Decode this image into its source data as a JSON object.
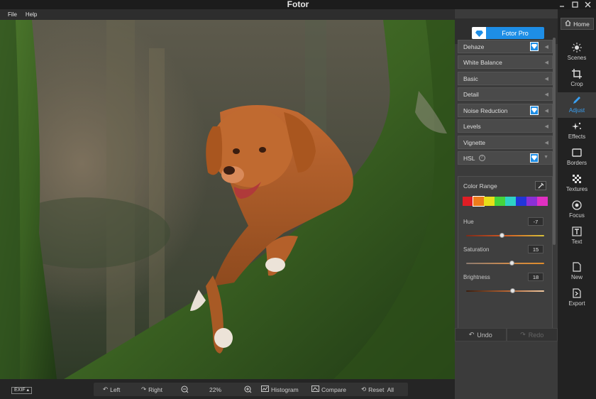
{
  "window": {
    "title": "Fotor",
    "minimize_icon": "minimize-icon",
    "maximize_icon": "maximize-icon",
    "close_icon": "close-icon"
  },
  "menu": [
    "File",
    "Help"
  ],
  "pro": {
    "label": "Fotor Pro"
  },
  "sections": [
    {
      "label": "Dehaze",
      "pro": true
    },
    {
      "label": "White Balance",
      "pro": false
    },
    {
      "label": "Basic",
      "pro": false
    },
    {
      "label": "Detail",
      "pro": false
    },
    {
      "label": "Noise Reduction",
      "pro": true
    },
    {
      "label": "Levels",
      "pro": false
    },
    {
      "label": "Vignette",
      "pro": false
    },
    {
      "label": "HSL",
      "pro": true
    }
  ],
  "hsl": {
    "color_range_label": "Color Range",
    "swatches": [
      "#e01e25",
      "#ee7c1a",
      "#e8e01a",
      "#45d43d",
      "#2fd1c5",
      "#2236d8",
      "#8a30d6",
      "#e030c2"
    ],
    "hue": {
      "label": "Hue",
      "value": "-7",
      "position": 0.45
    },
    "saturation": {
      "label": "Saturation",
      "value": "15",
      "position": 0.58
    },
    "brightness": {
      "label": "Brightness",
      "value": "18",
      "position": 0.59
    }
  },
  "history": {
    "undo": "Undo",
    "redo": "Redo"
  },
  "home": "Home",
  "tools": [
    {
      "label": "Scenes",
      "icon": "sun-icon"
    },
    {
      "label": "Crop",
      "icon": "crop-icon"
    },
    {
      "label": "Adjust",
      "icon": "pencil-icon",
      "active": true
    },
    {
      "label": "Effects",
      "icon": "sparkle-icon"
    },
    {
      "label": "Borders",
      "icon": "frame-icon"
    },
    {
      "label": "Textures",
      "icon": "texture-icon"
    },
    {
      "label": "Focus",
      "icon": "focus-icon"
    },
    {
      "label": "Text",
      "icon": "text-icon"
    },
    {
      "label": "New",
      "icon": "new-file-icon"
    },
    {
      "label": "Export",
      "icon": "export-icon"
    }
  ],
  "bottom": {
    "exif": "EXIF",
    "rotate_left": "Left",
    "rotate_right": "Right",
    "zoom": "22%",
    "histogram": "Histogram",
    "compare": "Compare",
    "reset_all": "Reset  All"
  },
  "accent": "#1e8ee6"
}
